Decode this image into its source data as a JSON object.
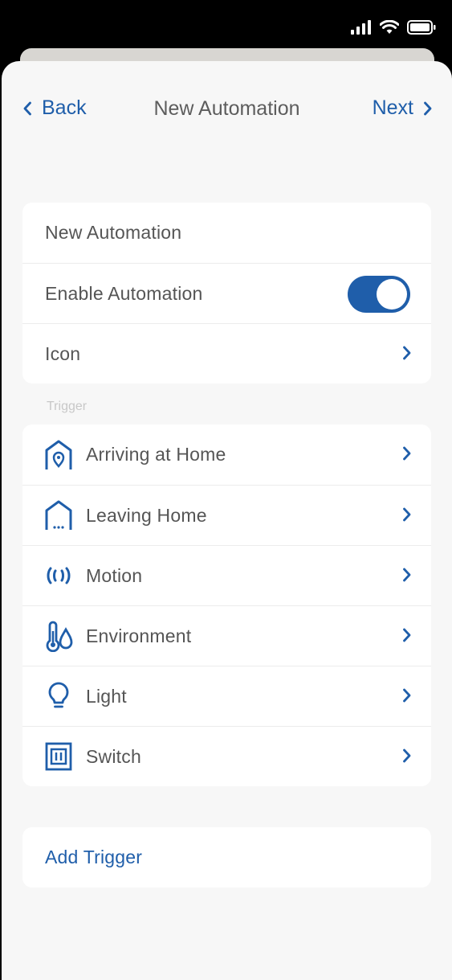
{
  "nav": {
    "back_label": "Back",
    "title": "New Automation",
    "next_label": "Next"
  },
  "settings": {
    "name": "New Automation",
    "enable_label": "Enable Automation",
    "enable_on": true,
    "icon_label": "Icon"
  },
  "trigger_section": {
    "label": "Trigger",
    "items": [
      {
        "label": "Arriving at Home",
        "icon": "arriving-home-icon"
      },
      {
        "label": "Leaving Home",
        "icon": "leaving-home-icon"
      },
      {
        "label": "Motion",
        "icon": "motion-icon"
      },
      {
        "label": "Environment",
        "icon": "environment-icon"
      },
      {
        "label": "Light",
        "icon": "light-bulb-icon"
      },
      {
        "label": "Switch",
        "icon": "switch-icon"
      }
    ]
  },
  "add_trigger_label": "Add Trigger",
  "colors": {
    "accent": "#1f5eaa",
    "background": "#f7f7f7",
    "text": "#555555"
  }
}
